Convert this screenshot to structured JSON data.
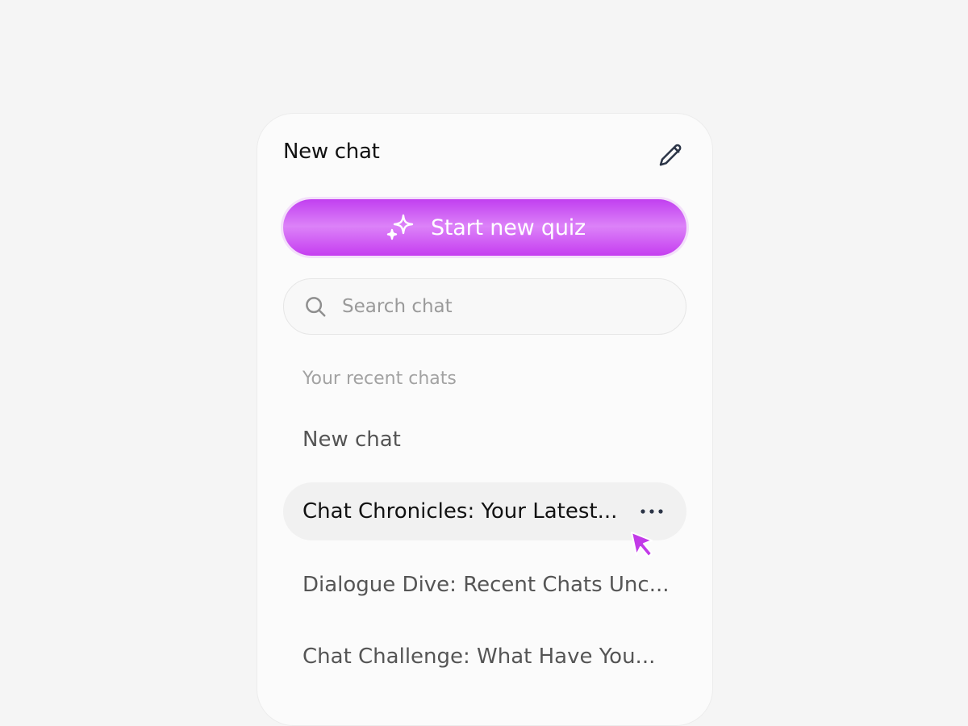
{
  "header": {
    "title": "New chat",
    "edit_icon": "pencil-icon"
  },
  "quiz_button": {
    "label": "Start new quiz",
    "icon": "sparkles-icon",
    "gradient": [
      "#c13ff0",
      "#dc82f8"
    ]
  },
  "search": {
    "placeholder": "Search chat",
    "value": "",
    "icon": "search-icon"
  },
  "recent": {
    "label": "Your recent chats",
    "items": [
      {
        "label": "New chat",
        "active": false
      },
      {
        "label": "Chat Chronicles: Your Latest...",
        "active": true,
        "menu_icon": "more-horizontal-icon"
      },
      {
        "label": "Dialogue Dive: Recent Chats Unc...",
        "active": false
      },
      {
        "label": "Chat Challenge: What Have You...",
        "active": false
      }
    ]
  },
  "colors": {
    "accent": "#c13ff0",
    "background": "#f5f5f5",
    "panel": "#fbfbfb",
    "active_item": "#f1f1f1"
  },
  "cursor_icon": "pointer-cursor-icon"
}
